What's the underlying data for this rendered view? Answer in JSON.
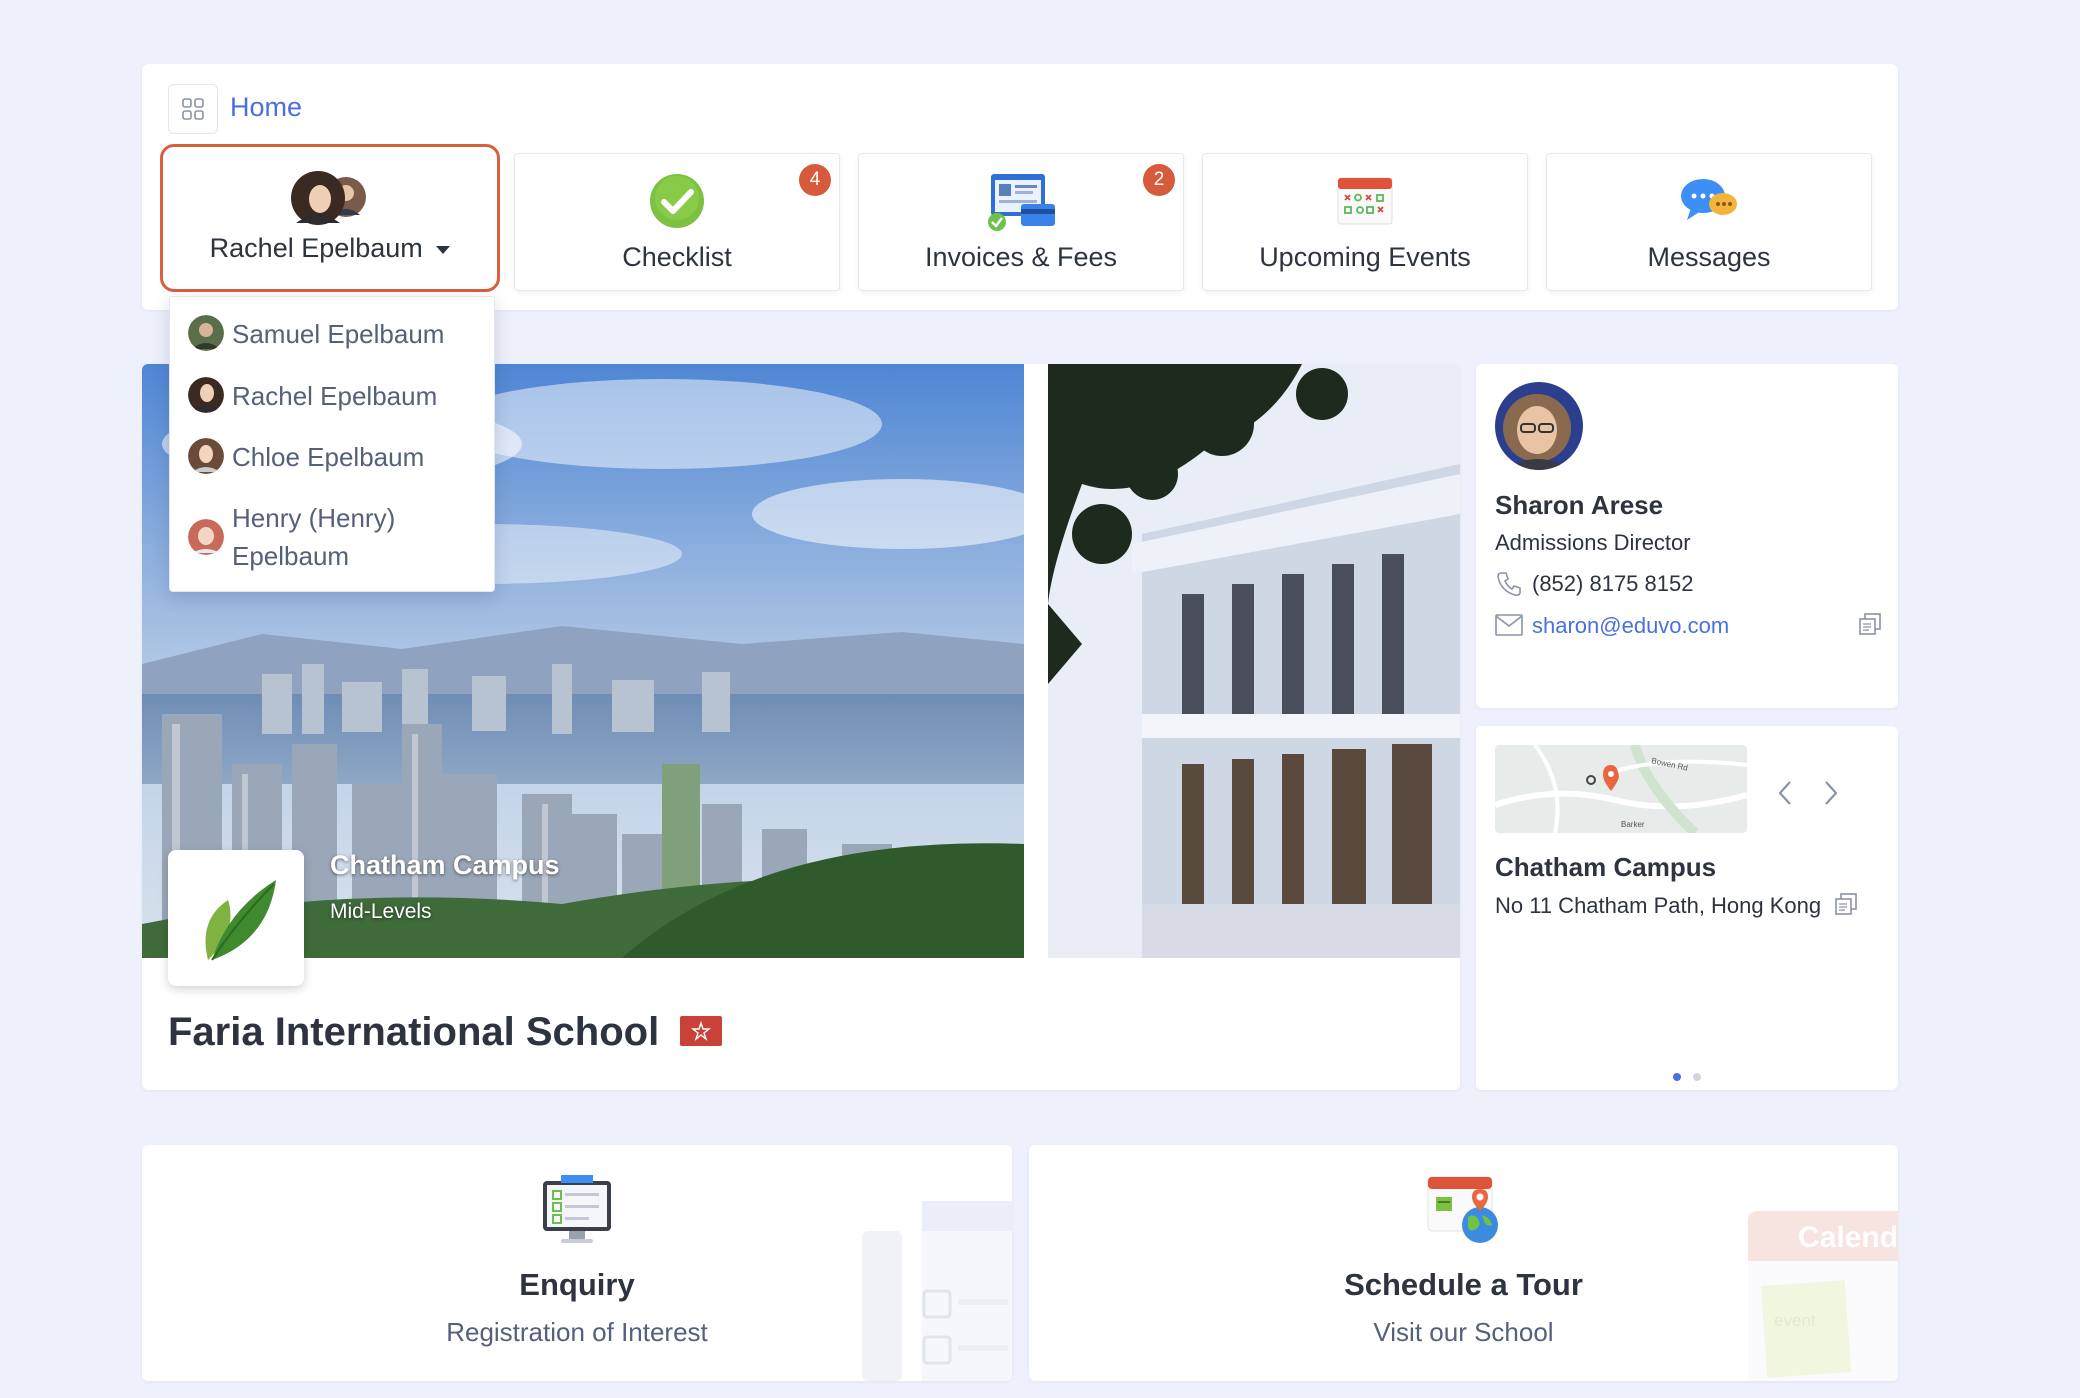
{
  "breadcrumb": {
    "home_label": "Home"
  },
  "nav_tiles": [
    {
      "label": "Rachel Epelbaum",
      "has_caret": true
    },
    {
      "label": "Checklist",
      "badge": "4"
    },
    {
      "label": "Invoices & Fees",
      "badge": "2"
    },
    {
      "label": "Upcoming Events"
    },
    {
      "label": "Messages"
    }
  ],
  "student_dropdown": {
    "items": [
      {
        "name": "Samuel Epelbaum"
      },
      {
        "name": "Rachel Epelbaum"
      },
      {
        "name": "Chloe Epelbaum"
      },
      {
        "name_line1": "Henry (Henry)",
        "name_line2": "Epelbaum"
      }
    ]
  },
  "hero": {
    "campus_title": "Chatham Campus",
    "campus_subtitle": "Mid-Levels",
    "school_name": "Faria International School"
  },
  "contact": {
    "name": "Sharon Arese",
    "role": "Admissions Director",
    "phone": "(852) 8175 8152",
    "email": "sharon@eduvo.com"
  },
  "location": {
    "map_labels": [
      "Bowen Rd",
      "Barker"
    ],
    "campus_name": "Chatham Campus",
    "address": "No 11 Chatham Path, Hong Kong",
    "carousel_pages": 2,
    "active_page": 1
  },
  "actions": [
    {
      "title": "Enquiry",
      "subtitle": "Registration of Interest"
    },
    {
      "title": "Schedule a Tour",
      "subtitle": "Visit our School",
      "bg_text_1": "Calend",
      "bg_text_2": "event"
    }
  ],
  "colors": {
    "accent": "#4a6fe0",
    "badge": "#d65a3b",
    "active_border": "#d8603c",
    "background": "#eef1fb"
  }
}
